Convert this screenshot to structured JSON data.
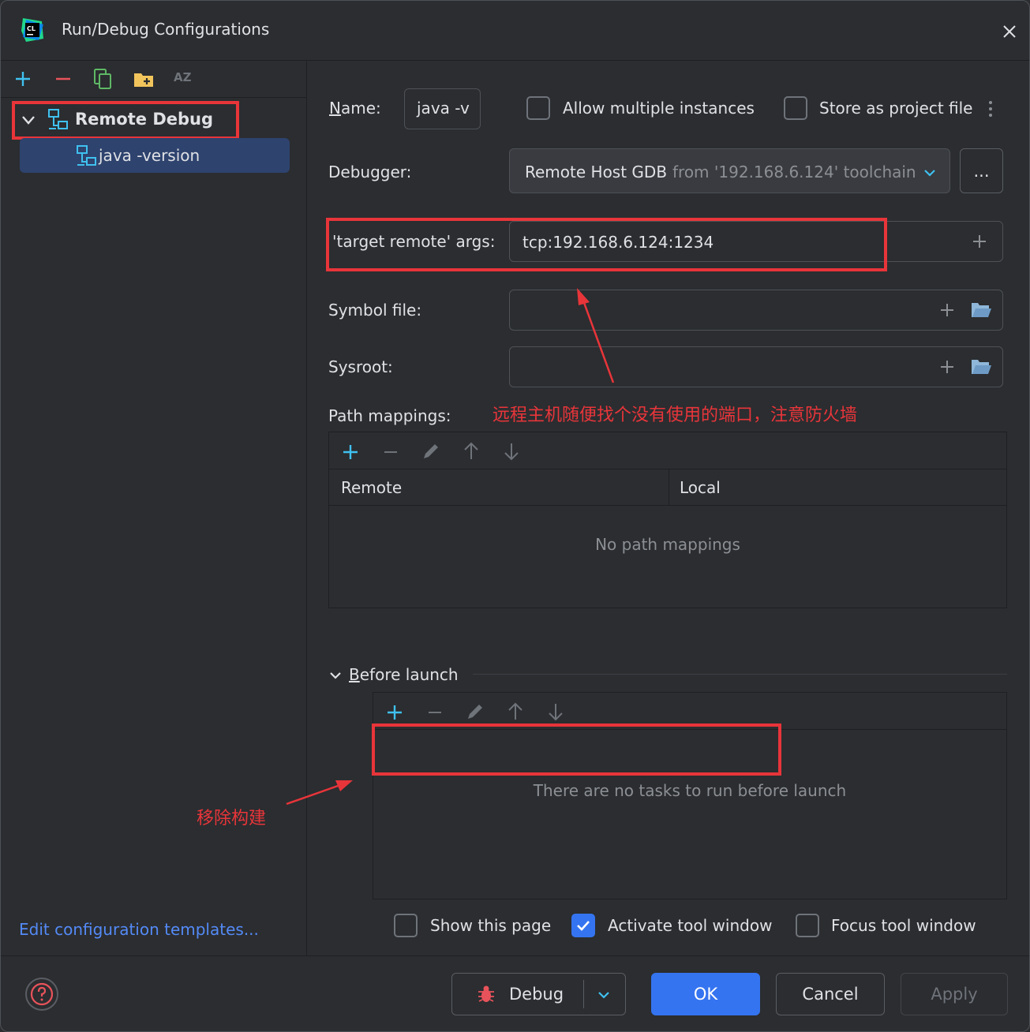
{
  "window": {
    "title": "Run/Debug Configurations",
    "app_logo_text": "CL"
  },
  "left_toolbar": {
    "icons": [
      "add-icon",
      "remove-icon",
      "copy-icon",
      "folder-add-icon",
      "sort-az-icon"
    ],
    "sort_label": "AZ"
  },
  "tree": {
    "group_label": "Remote Debug",
    "child_label": "java -version"
  },
  "edit_templates_link": "Edit configuration templates...",
  "form": {
    "name_label": "Name:",
    "name_value": "java -v",
    "allow_multiple_label": "Allow multiple instances",
    "store_project_label": "Store as project file",
    "debugger_label": "Debugger:",
    "debugger_value": "Remote Host GDB",
    "debugger_value_suffix": "from '192.168.6.124' toolchain",
    "debugger_more": "...",
    "target_args_label": "'target remote' args:",
    "target_args_value": "tcp:192.168.6.124:1234",
    "symbol_file_label": "Symbol file:",
    "symbol_file_value": "",
    "sysroot_label": "Sysroot:",
    "sysroot_value": "",
    "path_mappings_label": "Path mappings:",
    "path_table": {
      "columns": [
        "Remote",
        "Local"
      ],
      "empty_text": "No path mappings"
    },
    "before_launch_label": "Before launch",
    "before_launch_empty": "There are no tasks to run before launch",
    "show_page_label": "Show this page",
    "activate_tool_label": "Activate tool window",
    "focus_tool_label": "Focus tool window",
    "activate_checked": true
  },
  "annotations": {
    "port_note": "远程主机随便找个没有使用的端口，注意防火墙",
    "remove_build_note": "移除构建",
    "color": "#e8353a"
  },
  "footer": {
    "debug_label": "Debug",
    "ok_label": "OK",
    "cancel_label": "Cancel",
    "apply_label": "Apply"
  },
  "colors": {
    "accent": "#3574f0",
    "selection": "#2e436e",
    "annotation": "#e8353a",
    "background": "#2b2d30"
  }
}
